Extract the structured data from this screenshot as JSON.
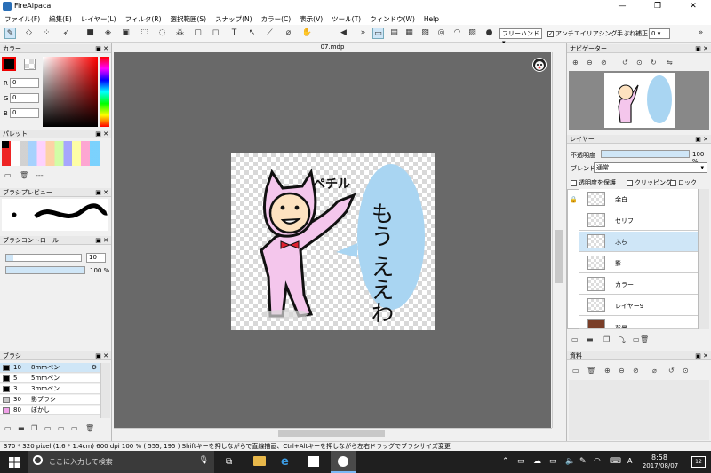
{
  "window": {
    "title": "FireAlpaca"
  },
  "menu": [
    "ファイル(F)",
    "編集(E)",
    "レイヤー(L)",
    "フィルタ(R)",
    "選択範囲(S)",
    "スナップ(N)",
    "カラー(C)",
    "表示(V)",
    "ツール(T)",
    "ウィンドウ(W)",
    "Help"
  ],
  "toolbar": {
    "brush_mode": "フリーハンド",
    "antialias_label": "アンチエイリアシング",
    "stabilizer_label": "手ぶれ補正",
    "stabilizer_value": "0"
  },
  "doc": {
    "tab": "07.mdp"
  },
  "color_panel": {
    "title": "カラー",
    "r_label": "R",
    "g_label": "G",
    "b_label": "B",
    "r": "0",
    "g": "0",
    "b": "0"
  },
  "palette_panel": {
    "title": "パレット",
    "dashes": "---"
  },
  "brush_preview": {
    "title": "ブラシプレビュー"
  },
  "brush_control": {
    "title": "ブラシコントロール",
    "size": "10",
    "opacity": "100 %"
  },
  "brush_panel": {
    "title": "ブラシ",
    "items": [
      {
        "size": "10",
        "name": "8mmペン",
        "color": "#000000"
      },
      {
        "size": "5",
        "name": "5mmペン",
        "color": "#000000"
      },
      {
        "size": "3",
        "name": "3mmペン",
        "color": "#000000"
      },
      {
        "size": "30",
        "name": "影ブラシ",
        "color": "#c8c8c8"
      },
      {
        "size": "80",
        "name": "ぼかし",
        "color": "#f0a0e8"
      }
    ]
  },
  "navigator": {
    "title": "ナビゲーター"
  },
  "layer_panel": {
    "title": "レイヤー",
    "opacity_label": "不透明度",
    "opacity_value": "100 %",
    "blend_label": "ブレンド",
    "blend_value": "通常",
    "protect_label": "透明度を保護",
    "clipping_label": "クリッピング",
    "lock_label": "ロック",
    "layers": [
      "余白",
      "セリフ",
      "ふち",
      "影",
      "カラー",
      "レイヤー9",
      "背景"
    ]
  },
  "material_panel": {
    "title": "資料"
  },
  "artwork": {
    "text_small": "ペチル",
    "text_big": "もう ええわ"
  },
  "status": {
    "text": "370 * 320 pixel  (1.6 * 1.4cm)  600 dpi  100 %  ( 555, 195 )  Shiftキーを押しながらで直線描画、Ctrl+Altキーを押しながら左右ドラッグでブラシサイズ変更"
  },
  "taskbar": {
    "search_placeholder": "ここに入力して検索",
    "time": "8:58",
    "date": "2017/08/07",
    "ime": "A",
    "notif_count": "12"
  },
  "colors": {
    "accent": "#cfe6f7",
    "bubble": "#a9d5f2",
    "pink": "#f4c6ec"
  }
}
